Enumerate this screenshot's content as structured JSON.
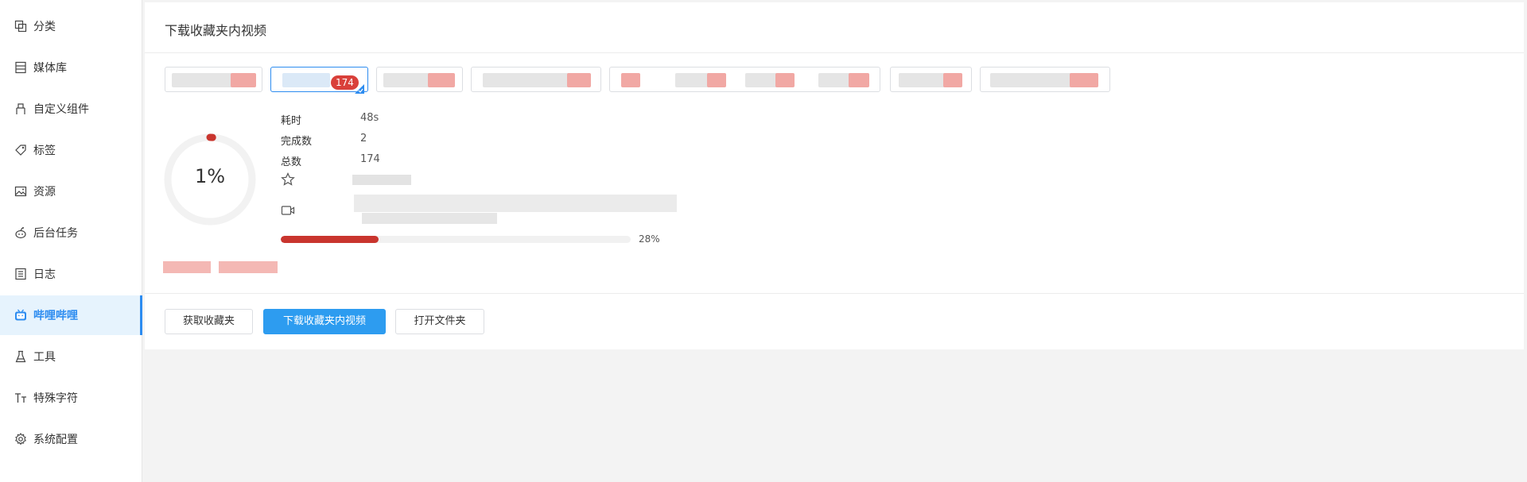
{
  "sidebar": {
    "items": [
      {
        "label": "分类",
        "icon": "copy-icon"
      },
      {
        "label": "媒体库",
        "icon": "library-icon"
      },
      {
        "label": "自定义组件",
        "icon": "component-icon"
      },
      {
        "label": "标签",
        "icon": "tag-icon"
      },
      {
        "label": "资源",
        "icon": "image-icon"
      },
      {
        "label": "后台任务",
        "icon": "robot-icon"
      },
      {
        "label": "日志",
        "icon": "log-icon"
      },
      {
        "label": "哔哩哔哩",
        "icon": "bilibili-icon",
        "active": true
      },
      {
        "label": "工具",
        "icon": "flask-icon"
      },
      {
        "label": "特殊字符",
        "icon": "text-size-icon"
      },
      {
        "label": "系统配置",
        "icon": "gear-icon"
      }
    ]
  },
  "panel": {
    "title": "下载收藏夹内视频"
  },
  "tags": {
    "selected_badge": "174"
  },
  "progress": {
    "percent_text": "1%",
    "percent_value": 1,
    "stats": [
      {
        "label": "耗时",
        "value": "48s"
      },
      {
        "label": "完成数",
        "value": "2"
      },
      {
        "label": "总数",
        "value": "174"
      }
    ],
    "current_bar_text": "28%",
    "current_bar_value": 0.28
  },
  "buttons": {
    "fetch": "获取收藏夹",
    "download": "下载收藏夹内视频",
    "open_folder": "打开文件夹"
  },
  "colors": {
    "accent": "#2d9cf0",
    "progress": "#c9352e"
  }
}
